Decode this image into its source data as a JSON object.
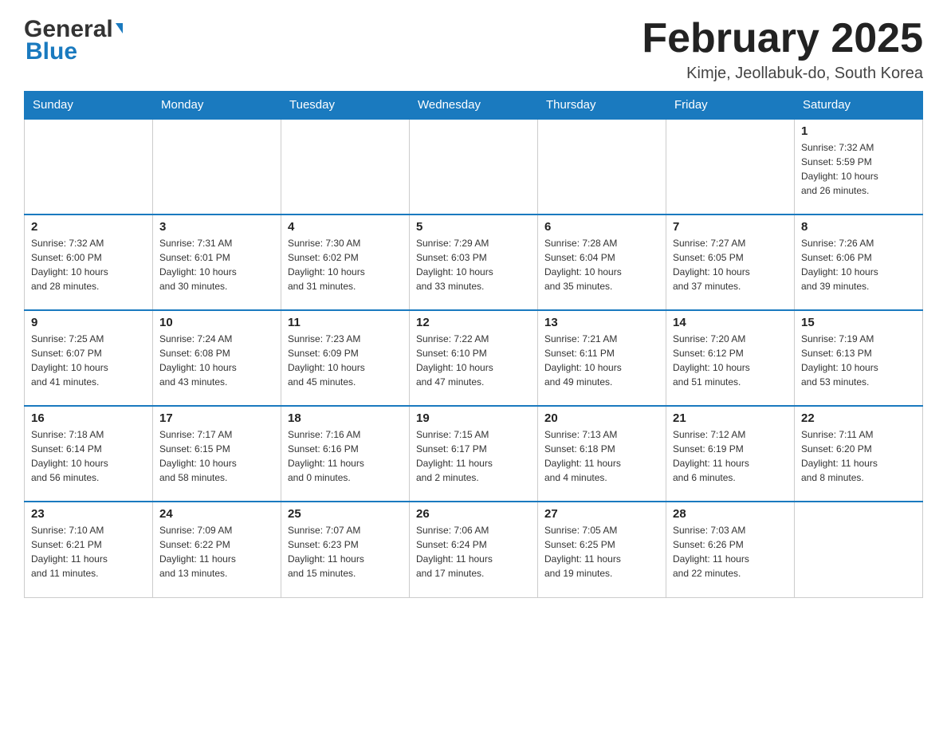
{
  "header": {
    "logo_general": "General",
    "logo_blue": "Blue",
    "month_title": "February 2025",
    "location": "Kimje, Jeollabuk-do, South Korea"
  },
  "days_of_week": [
    "Sunday",
    "Monday",
    "Tuesday",
    "Wednesday",
    "Thursday",
    "Friday",
    "Saturday"
  ],
  "weeks": [
    [
      {
        "day": "",
        "info": ""
      },
      {
        "day": "",
        "info": ""
      },
      {
        "day": "",
        "info": ""
      },
      {
        "day": "",
        "info": ""
      },
      {
        "day": "",
        "info": ""
      },
      {
        "day": "",
        "info": ""
      },
      {
        "day": "1",
        "info": "Sunrise: 7:32 AM\nSunset: 5:59 PM\nDaylight: 10 hours\nand 26 minutes."
      }
    ],
    [
      {
        "day": "2",
        "info": "Sunrise: 7:32 AM\nSunset: 6:00 PM\nDaylight: 10 hours\nand 28 minutes."
      },
      {
        "day": "3",
        "info": "Sunrise: 7:31 AM\nSunset: 6:01 PM\nDaylight: 10 hours\nand 30 minutes."
      },
      {
        "day": "4",
        "info": "Sunrise: 7:30 AM\nSunset: 6:02 PM\nDaylight: 10 hours\nand 31 minutes."
      },
      {
        "day": "5",
        "info": "Sunrise: 7:29 AM\nSunset: 6:03 PM\nDaylight: 10 hours\nand 33 minutes."
      },
      {
        "day": "6",
        "info": "Sunrise: 7:28 AM\nSunset: 6:04 PM\nDaylight: 10 hours\nand 35 minutes."
      },
      {
        "day": "7",
        "info": "Sunrise: 7:27 AM\nSunset: 6:05 PM\nDaylight: 10 hours\nand 37 minutes."
      },
      {
        "day": "8",
        "info": "Sunrise: 7:26 AM\nSunset: 6:06 PM\nDaylight: 10 hours\nand 39 minutes."
      }
    ],
    [
      {
        "day": "9",
        "info": "Sunrise: 7:25 AM\nSunset: 6:07 PM\nDaylight: 10 hours\nand 41 minutes."
      },
      {
        "day": "10",
        "info": "Sunrise: 7:24 AM\nSunset: 6:08 PM\nDaylight: 10 hours\nand 43 minutes."
      },
      {
        "day": "11",
        "info": "Sunrise: 7:23 AM\nSunset: 6:09 PM\nDaylight: 10 hours\nand 45 minutes."
      },
      {
        "day": "12",
        "info": "Sunrise: 7:22 AM\nSunset: 6:10 PM\nDaylight: 10 hours\nand 47 minutes."
      },
      {
        "day": "13",
        "info": "Sunrise: 7:21 AM\nSunset: 6:11 PM\nDaylight: 10 hours\nand 49 minutes."
      },
      {
        "day": "14",
        "info": "Sunrise: 7:20 AM\nSunset: 6:12 PM\nDaylight: 10 hours\nand 51 minutes."
      },
      {
        "day": "15",
        "info": "Sunrise: 7:19 AM\nSunset: 6:13 PM\nDaylight: 10 hours\nand 53 minutes."
      }
    ],
    [
      {
        "day": "16",
        "info": "Sunrise: 7:18 AM\nSunset: 6:14 PM\nDaylight: 10 hours\nand 56 minutes."
      },
      {
        "day": "17",
        "info": "Sunrise: 7:17 AM\nSunset: 6:15 PM\nDaylight: 10 hours\nand 58 minutes."
      },
      {
        "day": "18",
        "info": "Sunrise: 7:16 AM\nSunset: 6:16 PM\nDaylight: 11 hours\nand 0 minutes."
      },
      {
        "day": "19",
        "info": "Sunrise: 7:15 AM\nSunset: 6:17 PM\nDaylight: 11 hours\nand 2 minutes."
      },
      {
        "day": "20",
        "info": "Sunrise: 7:13 AM\nSunset: 6:18 PM\nDaylight: 11 hours\nand 4 minutes."
      },
      {
        "day": "21",
        "info": "Sunrise: 7:12 AM\nSunset: 6:19 PM\nDaylight: 11 hours\nand 6 minutes."
      },
      {
        "day": "22",
        "info": "Sunrise: 7:11 AM\nSunset: 6:20 PM\nDaylight: 11 hours\nand 8 minutes."
      }
    ],
    [
      {
        "day": "23",
        "info": "Sunrise: 7:10 AM\nSunset: 6:21 PM\nDaylight: 11 hours\nand 11 minutes."
      },
      {
        "day": "24",
        "info": "Sunrise: 7:09 AM\nSunset: 6:22 PM\nDaylight: 11 hours\nand 13 minutes."
      },
      {
        "day": "25",
        "info": "Sunrise: 7:07 AM\nSunset: 6:23 PM\nDaylight: 11 hours\nand 15 minutes."
      },
      {
        "day": "26",
        "info": "Sunrise: 7:06 AM\nSunset: 6:24 PM\nDaylight: 11 hours\nand 17 minutes."
      },
      {
        "day": "27",
        "info": "Sunrise: 7:05 AM\nSunset: 6:25 PM\nDaylight: 11 hours\nand 19 minutes."
      },
      {
        "day": "28",
        "info": "Sunrise: 7:03 AM\nSunset: 6:26 PM\nDaylight: 11 hours\nand 22 minutes."
      },
      {
        "day": "",
        "info": ""
      }
    ]
  ]
}
